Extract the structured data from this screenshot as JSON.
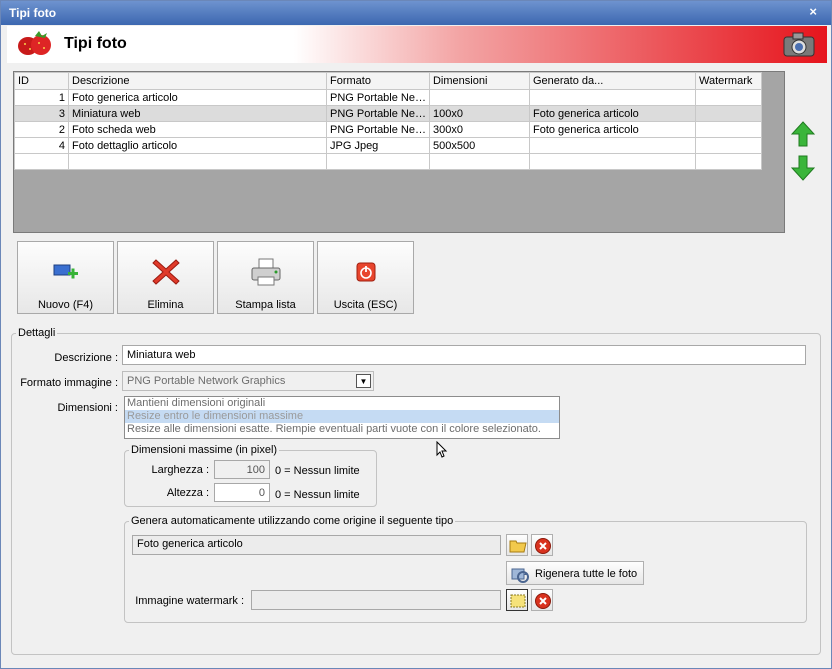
{
  "window": {
    "title": "Tipi foto",
    "close_glyph": "×"
  },
  "banner": {
    "title": "Tipi foto",
    "logo_icon": "strawberry-icon",
    "right_icon": "camera-icon",
    "gradient_color": "#e6141c"
  },
  "grid": {
    "headers": [
      "ID",
      "Descrizione",
      "Formato",
      "Dimensioni",
      "Generato da...",
      "Watermark"
    ],
    "rows": [
      {
        "id": "1",
        "descrizione": "Foto generica articolo",
        "formato": "PNG Portable Ne…",
        "dimensioni": "",
        "generato": "",
        "watermark": ""
      },
      {
        "id": "3",
        "descrizione": "Miniatura web",
        "formato": "PNG Portable Ne…",
        "dimensioni": "100x0",
        "generato": "Foto generica articolo",
        "watermark": ""
      },
      {
        "id": "2",
        "descrizione": "Foto scheda web",
        "formato": "PNG Portable Ne…",
        "dimensioni": "300x0",
        "generato": "Foto generica articolo",
        "watermark": ""
      },
      {
        "id": "4",
        "descrizione": "Foto dettaglio articolo",
        "formato": "JPG Jpeg",
        "dimensioni": "500x500",
        "generato": "",
        "watermark": ""
      }
    ]
  },
  "side": {
    "up_icon": "arrow-up-icon",
    "down_icon": "arrow-down-icon"
  },
  "toolbar": {
    "nuovo": "Nuovo (F4)",
    "elimina": "Elimina",
    "stampa": "Stampa lista",
    "uscita": "Uscita (ESC)"
  },
  "details": {
    "legend": "Dettagli",
    "descrizione_label": "Descrizione :",
    "descrizione_value": "Miniatura web",
    "formato_label": "Formato immagine :",
    "formato_value": "PNG Portable Network Graphics",
    "dimensioni_label": "Dimensioni :",
    "dimensioni_options": [
      "Mantieni dimensioni originali",
      "Resize entro le dimensioni massime",
      "Resize alle dimensioni esatte. Riempie eventuali parti vuote con il colore selezionato."
    ],
    "max": {
      "legend": "Dimensioni massime (in pixel)",
      "larghezza_label": "Larghezza :",
      "larghezza_value": "100",
      "altezza_label": "Altezza :",
      "altezza_value": "0",
      "hint": "0 = Nessun limite"
    },
    "auto": {
      "legend": "Genera automaticamente utilizzando come origine il seguente tipo",
      "origine_value": "Foto generica articolo",
      "regen_label": "Rigenera tutte le foto",
      "watermark_label": "Immagine watermark :",
      "watermark_value": ""
    }
  }
}
